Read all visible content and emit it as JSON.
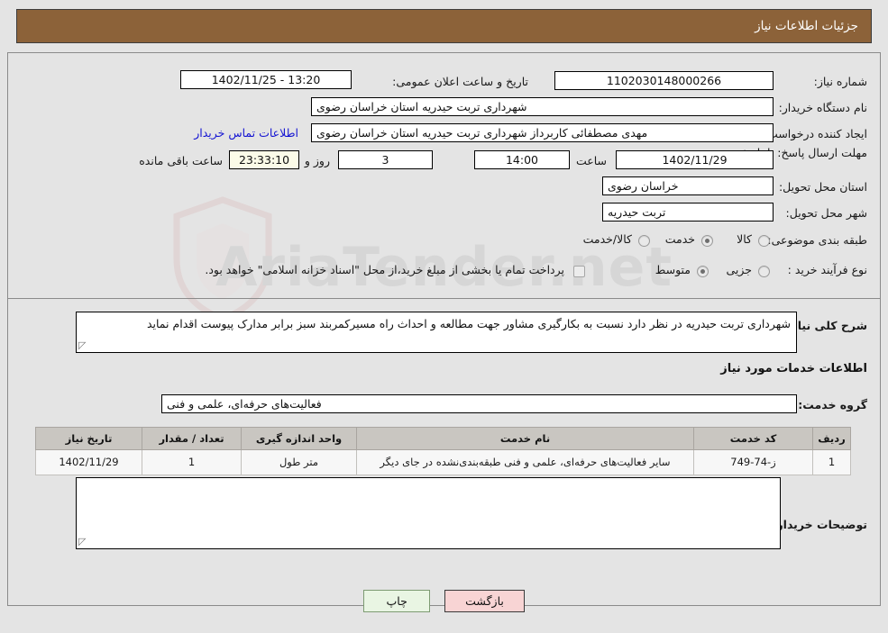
{
  "header": {
    "title": "جزئیات اطلاعات نیاز"
  },
  "form": {
    "need_number_label": "شماره نیاز:",
    "need_number_value": "1102030148000266",
    "announce_label": "تاریخ و ساعت اعلان عمومی:",
    "announce_value": "13:20 - 1402/11/25",
    "buyer_org_label": "نام دستگاه خریدار:",
    "buyer_org_value": "شهرداری تربت حیدریه استان خراسان رضوی",
    "requester_label": "ایجاد کننده درخواست:",
    "requester_value": "مهدی مصطفائی کاربرداز شهرداری تربت حیدریه استان خراسان رضوی",
    "contact_link": "اطلاعات تماس خریدار",
    "deadline_label": "مهلت ارسال پاسخ: تا تاریخ:",
    "deadline_date": "1402/11/29",
    "hour_label": "ساعت",
    "hour_value": "14:00",
    "days_value": "3",
    "days_label": "روز و",
    "countdown_value": "23:33:10",
    "countdown_label": "ساعت باقی مانده",
    "province_label": "استان محل تحویل:",
    "province_value": "خراسان رضوی",
    "city_label": "شهر محل تحویل:",
    "city_value": "تربت حیدریه",
    "category_label": "طبقه بندی موضوعی:",
    "category_options": [
      "کالا",
      "خدمت",
      "کالا/خدمت"
    ],
    "category_selected": "خدمت",
    "process_label": "نوع فرآیند خرید :",
    "process_options": [
      "جزیی",
      "متوسط"
    ],
    "process_selected": "متوسط",
    "treasury_note": "پرداخت تمام یا بخشی از مبلغ خرید،از محل \"اسناد خزانه اسلامی\" خواهد بود.",
    "treasury_checked": false
  },
  "description": {
    "label": "شرح کلی نیاز:",
    "value": "شهرداری تربت حیدریه در نظر دارد نسبت به بکارگیری مشاور جهت مطالعه و احداث راه مسیرکمربند سبز برابر مدارک پیوست اقدام نماید"
  },
  "services_section": {
    "heading": "اطلاعات خدمات مورد نیاز",
    "group_label": "گروه خدمت:",
    "group_value": "فعالیت‌های حرفه‌ای، علمی و فنی"
  },
  "table": {
    "headers": [
      "ردیف",
      "کد خدمت",
      "نام خدمت",
      "واحد اندازه گیری",
      "تعداد / مقدار",
      "تاریخ نیاز"
    ],
    "rows": [
      {
        "row": "1",
        "code": "ز-74-749",
        "name": "سایر فعالیت‌های حرفه‌ای، علمی و فنی طبقه‌بندی‌نشده در جای دیگر",
        "unit": "متر طول",
        "qty": "1",
        "date": "1402/11/29"
      }
    ]
  },
  "buyer_notes": {
    "label": "توضیحات خریدار:",
    "value": ""
  },
  "buttons": {
    "print": "چاپ",
    "back": "بازگشت"
  },
  "watermark": {
    "text": "AriaTender.net"
  },
  "colors": {
    "header_bg": "#8c6239",
    "link": "#1414d2",
    "print_bg": "#e9f5e3",
    "back_bg": "#f8d4d4",
    "table_header_bg": "#c9c6c1",
    "countdown_bg": "#fbfbe8"
  }
}
